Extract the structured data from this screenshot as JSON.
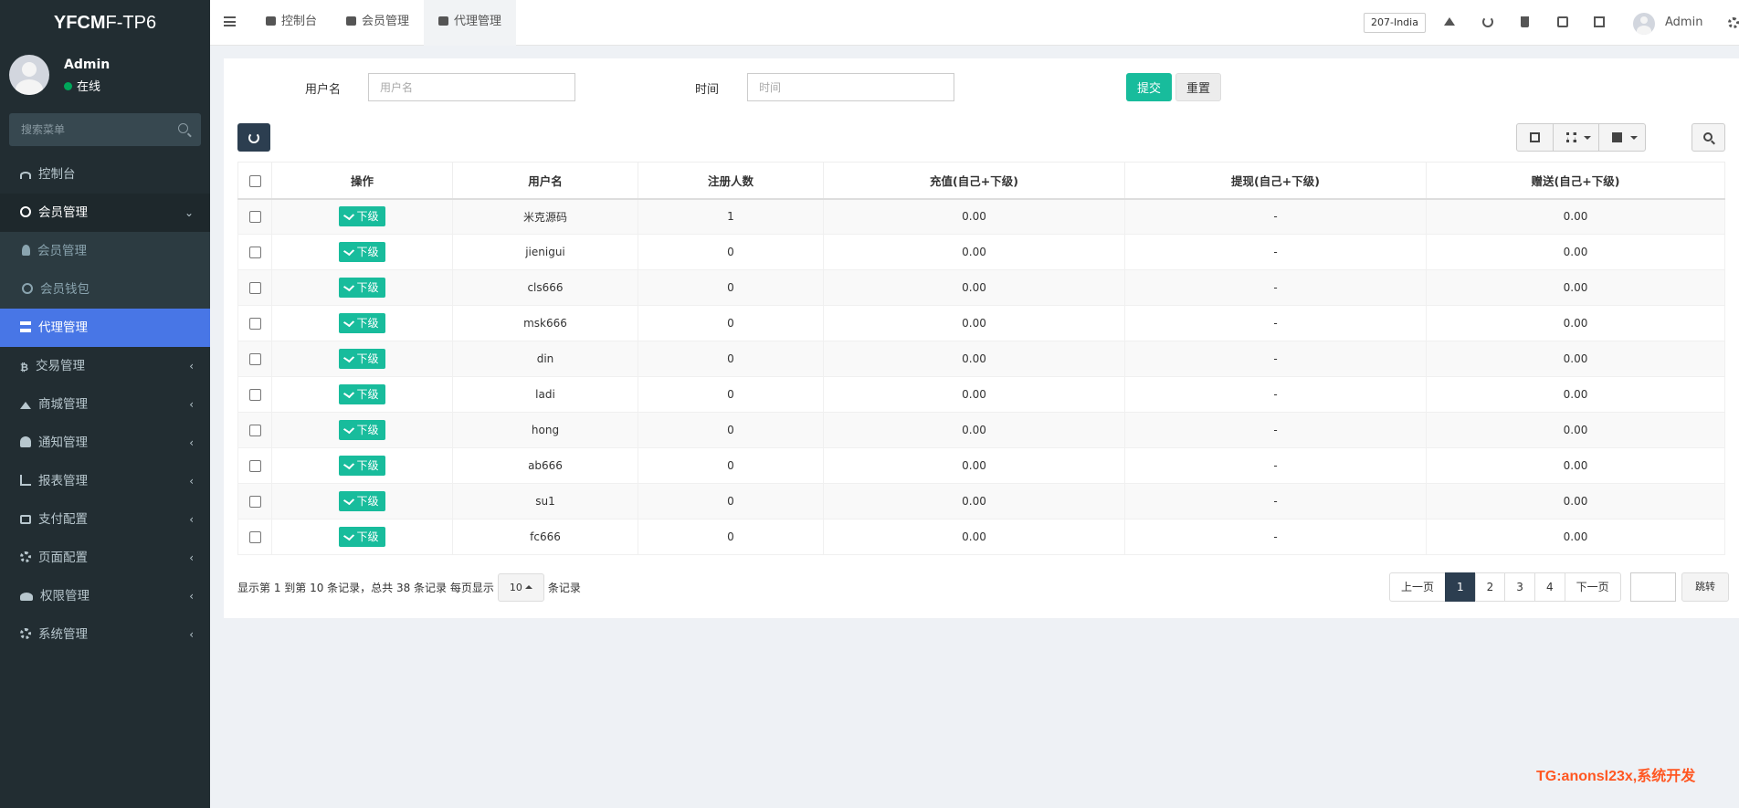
{
  "app": {
    "logo_bold": "YFCM",
    "logo_rest": "F-TP6"
  },
  "user": {
    "name": "Admin",
    "status": "在线"
  },
  "sidebar": {
    "search_placeholder": "搜索菜单",
    "items": [
      {
        "label": "控制台",
        "icon": "dashboard-icon"
      },
      {
        "label": "会员管理",
        "icon": "user-circle-icon"
      },
      {
        "label": "会员管理",
        "icon": "user-icon"
      },
      {
        "label": "会员钱包",
        "icon": "wallet-icon"
      },
      {
        "label": "代理管理",
        "icon": "sitemap-icon"
      },
      {
        "label": "交易管理",
        "icon": "bitcoin-icon"
      },
      {
        "label": "商城管理",
        "icon": "home-icon"
      },
      {
        "label": "通知管理",
        "icon": "bell-icon"
      },
      {
        "label": "报表管理",
        "icon": "chart-icon"
      },
      {
        "label": "支付配置",
        "icon": "credit-card-icon"
      },
      {
        "label": "页面配置",
        "icon": "gear-icon"
      },
      {
        "label": "权限管理",
        "icon": "users-icon"
      },
      {
        "label": "系统管理",
        "icon": "gears-icon"
      }
    ]
  },
  "topbar": {
    "tabs": [
      "控制台",
      "会员管理",
      "代理管理"
    ],
    "lang": "207-India",
    "admin": "Admin"
  },
  "form": {
    "username_label": "用户名",
    "username_placeholder": "用户名",
    "time_label": "时间",
    "time_placeholder": "时间",
    "submit": "提交",
    "reset": "重置"
  },
  "table": {
    "columns": [
      "操作",
      "用户名",
      "注册人数",
      "充值(自己+下级)",
      "提现(自己+下级)",
      "赠送(自己+下级)"
    ],
    "action_label": "下级",
    "rows": [
      {
        "username": "米克源码",
        "registered": "1",
        "recharge": "0.00",
        "withdraw": "-",
        "gift": "0.00"
      },
      {
        "username": "jienigui",
        "registered": "0",
        "recharge": "0.00",
        "withdraw": "-",
        "gift": "0.00"
      },
      {
        "username": "cls666",
        "registered": "0",
        "recharge": "0.00",
        "withdraw": "-",
        "gift": "0.00"
      },
      {
        "username": "msk666",
        "registered": "0",
        "recharge": "0.00",
        "withdraw": "-",
        "gift": "0.00"
      },
      {
        "username": "din",
        "registered": "0",
        "recharge": "0.00",
        "withdraw": "-",
        "gift": "0.00"
      },
      {
        "username": "ladi",
        "registered": "0",
        "recharge": "0.00",
        "withdraw": "-",
        "gift": "0.00"
      },
      {
        "username": "hong",
        "registered": "0",
        "recharge": "0.00",
        "withdraw": "-",
        "gift": "0.00"
      },
      {
        "username": "ab666",
        "registered": "0",
        "recharge": "0.00",
        "withdraw": "-",
        "gift": "0.00"
      },
      {
        "username": "su1",
        "registered": "0",
        "recharge": "0.00",
        "withdraw": "-",
        "gift": "0.00"
      },
      {
        "username": "fc666",
        "registered": "0",
        "recharge": "0.00",
        "withdraw": "-",
        "gift": "0.00"
      }
    ]
  },
  "pager": {
    "info": "显示第 1 到第 10 条记录，总共 38 条记录 每页显示",
    "page_size": "10",
    "suffix": "条记录",
    "prev": "上一页",
    "pages": [
      "1",
      "2",
      "3",
      "4"
    ],
    "next": "下一页",
    "jump": "跳转"
  },
  "watermark": "TG:anonsl23x,系统开发"
}
